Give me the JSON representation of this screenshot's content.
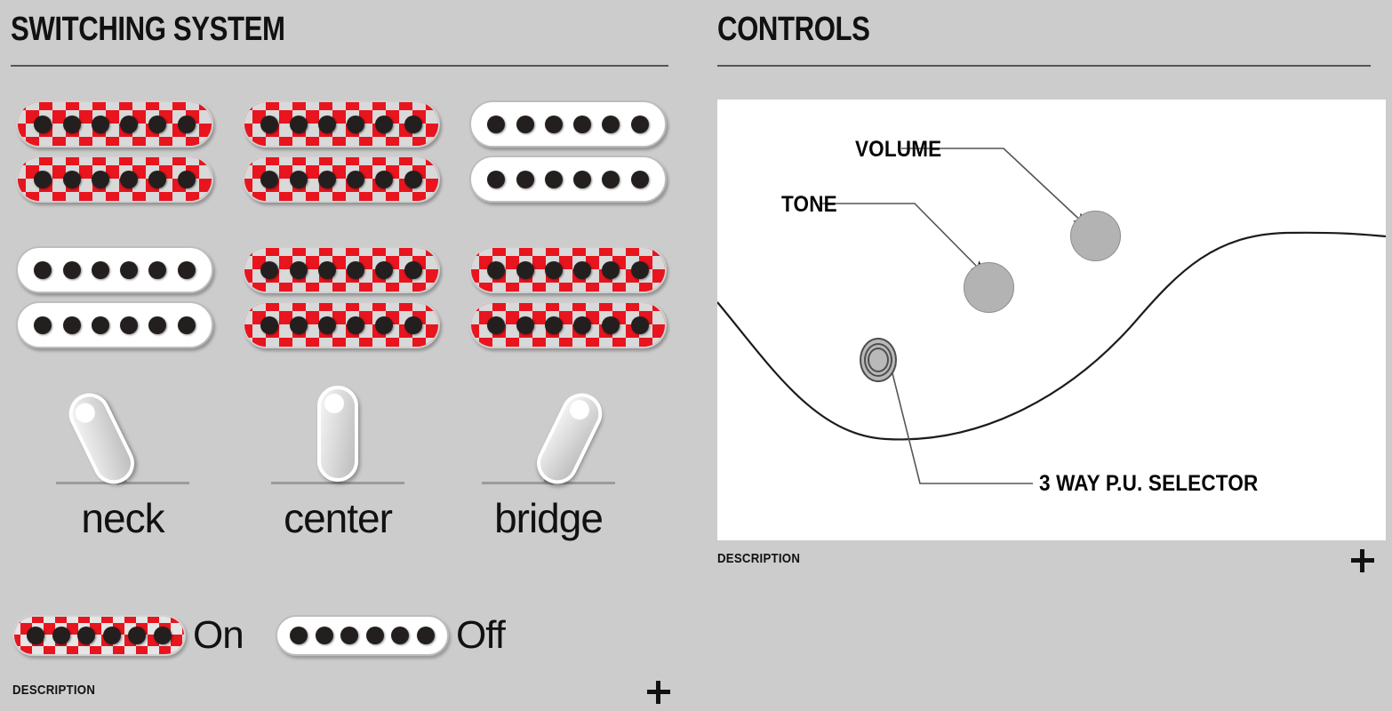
{
  "panels": {
    "switching": {
      "title": "SWITCHING SYSTEM",
      "pickup_grid": [
        [
          {
            "state": "on",
            "coils": 2,
            "poles": 6
          },
          {
            "state": "on",
            "coils": 2,
            "poles": 6
          },
          {
            "state": "off",
            "coils": 2,
            "poles": 6
          }
        ],
        [
          {
            "state": "off",
            "coils": 2,
            "poles": 6
          },
          {
            "state": "on",
            "coils": 2,
            "poles": 6
          },
          {
            "state": "on",
            "coils": 2,
            "poles": 6
          }
        ]
      ],
      "switches": [
        {
          "label": "neck",
          "position": "left"
        },
        {
          "label": "center",
          "position": "middle"
        },
        {
          "label": "bridge",
          "position": "right"
        }
      ],
      "legend": [
        {
          "state": "on",
          "label": "On"
        },
        {
          "state": "off",
          "label": "Off"
        }
      ],
      "description": {
        "label": "DESCRIPTION",
        "expand_icon": "plus-icon"
      }
    },
    "controls": {
      "title": "CONTROLS",
      "callouts": [
        {
          "label": "VOLUME",
          "target": "volume-knob"
        },
        {
          "label": "TONE",
          "target": "tone-knob"
        },
        {
          "label": "3 WAY P.U. SELECTOR",
          "target": "pickup-selector"
        }
      ],
      "description": {
        "label": "DESCRIPTION",
        "expand_icon": "plus-icon"
      }
    }
  },
  "colors": {
    "background": "#cccccc",
    "pickup_on": "#e8141e",
    "pickup_off": "#ffffff",
    "pole_piece": "#231f1e",
    "knob": "#b3b3b3",
    "canvas": "#ffffff",
    "text": "#111111"
  }
}
